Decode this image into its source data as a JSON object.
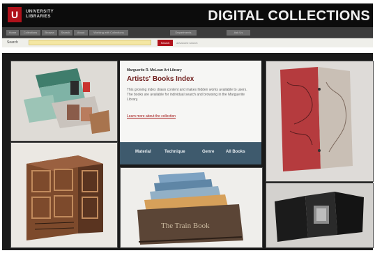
{
  "header": {
    "logo_mark": "U",
    "university_line1": "UNIVERSITY",
    "university_line2": "LIBRARIES",
    "site_title": "DIGITAL COLLECTIONS"
  },
  "nav": {
    "items": [
      "Home",
      "Collections",
      "Browse",
      "Search",
      "About",
      "Working with Collections",
      "Departments",
      "Ask Us"
    ]
  },
  "search": {
    "label": "Search",
    "value": "",
    "button_label": "Search",
    "advanced_link": "advanced search"
  },
  "feature": {
    "subtitle": "Marguerite R. McLean Art Library",
    "title": "Artists' Books Index",
    "description": "This growing index draws content and makes hidden works available to users. The books are available for individual search and browsing in the Marguerite Library.",
    "link": "Learn more about the collection",
    "browse_items": [
      "Material",
      "Technique",
      "Genre",
      "All Books"
    ]
  },
  "tiles": {
    "cover_text": "The Train Book"
  },
  "colors": {
    "brand_red": "#b0121b",
    "header_bg": "#0c0c0c",
    "browse_bar": "#3e5a6d",
    "title_text": "#6f1d1b"
  }
}
